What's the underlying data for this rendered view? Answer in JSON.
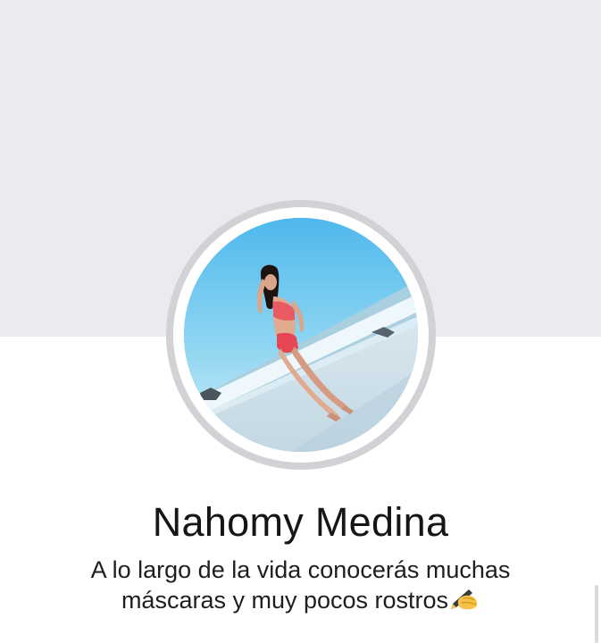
{
  "profile": {
    "name": "Nahomy Medina",
    "bio_line_1": "A lo largo de la vida conocerás muchas",
    "bio_line_2": "máscaras y muy pocos rostros",
    "bio_emoji_icon": "writing-hand-icon"
  },
  "colors": {
    "cover_background": "#e9ebee",
    "page_background": "#ffffff",
    "avatar_ring": "#d0d2d6",
    "text": "#161616"
  }
}
